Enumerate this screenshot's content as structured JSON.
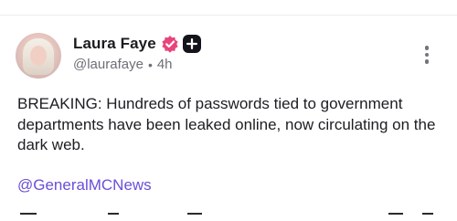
{
  "post": {
    "author": {
      "name": "Laura Faye",
      "handle": "@laurafaye",
      "avatar_icon": "profile-photo",
      "badges": [
        "verified-badge-icon",
        "plus-badge-icon"
      ],
      "verified_color": "#e8447a"
    },
    "separator": "•",
    "timestamp": "4h",
    "text": "BREAKING: Hundreds of passwords tied to government departments have been leaked online, now circulating on the dark web.",
    "mention": "@GeneralMCNews",
    "mention_color": "#6a4fd8"
  },
  "actions": {
    "menu_icon": "more-vertical-icon"
  }
}
